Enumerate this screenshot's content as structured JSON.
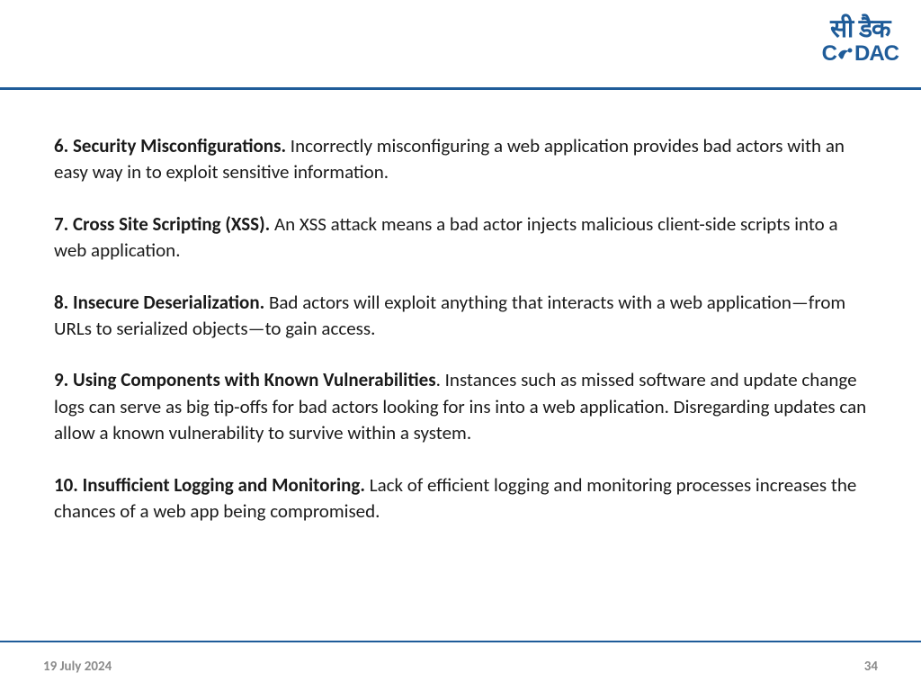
{
  "logo": {
    "hindi": "सी डैक",
    "english_c": "C",
    "english_dac": "DAC"
  },
  "items": [
    {
      "title": "6. Security Misconfigurations.",
      "body": " Incorrectly misconfiguring a web application provides bad actors with an easy way in to exploit sensitive information."
    },
    {
      "title": "7. Cross Site Scripting (XSS).",
      "body": " An XSS attack means a bad actor injects malicious client-side scripts into a web application."
    },
    {
      "title": "8. Insecure Deserialization.",
      "body": " Bad actors will exploit anything that interacts with a web application—from URLs to serialized objects—to gain access."
    },
    {
      "title": "9. Using Components with Known Vulnerabilities",
      "body": ". Instances such as missed software and update change logs can serve as big tip-offs for bad actors looking for ins into a web application. Disregarding updates can allow a known vulnerability to survive within a system."
    },
    {
      "title": "10. Insufficient Logging and Monitoring.",
      "body": " Lack of efficient logging and monitoring processes increases the chances of a web app being compromised."
    }
  ],
  "footer": {
    "date": "19 July 2024",
    "page": "34"
  },
  "colors": {
    "brand": "#1f5c99",
    "text": "#1a1a1a",
    "footerText": "#8a8a8a"
  }
}
